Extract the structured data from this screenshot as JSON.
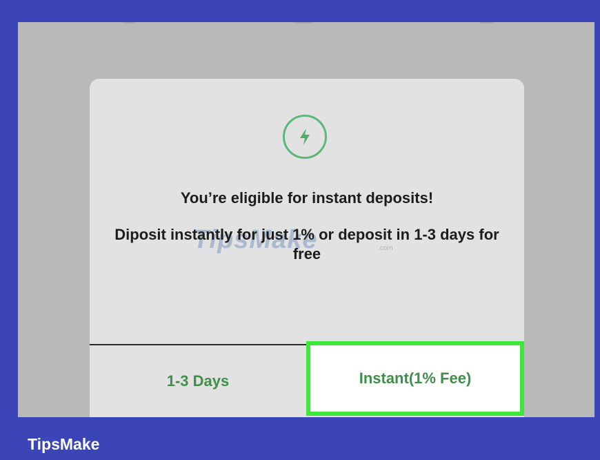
{
  "dialog": {
    "icon": "lightning-bolt-icon",
    "title": "You’re eligible for instant deposits!",
    "body": "Diposit instantly for just 1% or deposit in 1-3 days for free",
    "buttons": {
      "standard_label": "1-3 Days",
      "instant_label": "Instant(1% Fee)"
    }
  },
  "watermark": {
    "text": "TipsMake",
    "suffix": ".com"
  },
  "footer": {
    "brand": "TipsMake"
  },
  "colors": {
    "accent_green": "#3f8f4a",
    "highlight_green": "#3fe63b",
    "frame_blue": "#3b45b8",
    "icon_green": "#5cb87a"
  }
}
